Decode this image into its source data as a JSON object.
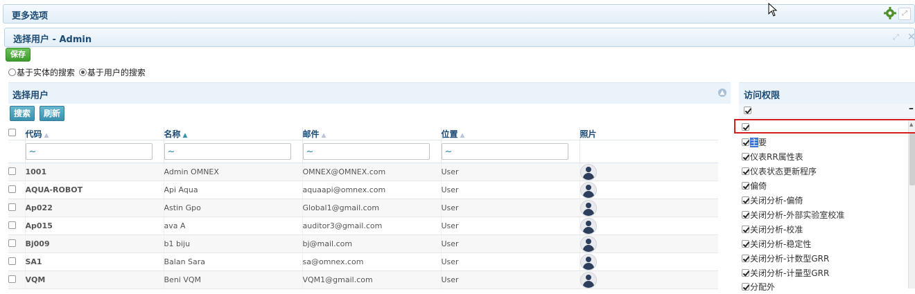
{
  "more_options": {
    "title": "更多选项"
  },
  "select_user_panel": {
    "title": "选择用户 - Admin"
  },
  "save_label": "保存",
  "search_mode": {
    "entity": "基于实体的搜索",
    "user": "基于用户的搜索",
    "selected": "user"
  },
  "user_grid": {
    "title": "选择用户",
    "search_label": "搜索",
    "refresh_label": "刷新",
    "columns": [
      "代码",
      "名称",
      "邮件",
      "位置",
      "照片"
    ],
    "filter_value": "~",
    "rows": [
      {
        "code": "1001",
        "name": "Admin OMNEX",
        "email": "OMNEX@OMNEX.com",
        "location": "User"
      },
      {
        "code": "AQUA-ROBOT",
        "name": "Api Aqua",
        "email": "aquaapi@omnex.com",
        "location": "User"
      },
      {
        "code": "Ap022",
        "name": "Astin Gpo",
        "email": "Global1@gmail.com",
        "location": "User"
      },
      {
        "code": "Ap015",
        "name": "ava A",
        "email": "auditor3@gmail.com",
        "location": "User"
      },
      {
        "code": "Bj009",
        "name": "b1 biju",
        "email": "bj@mail.com",
        "location": "User"
      },
      {
        "code": "SA1",
        "name": "Balan Sara",
        "email": "sa@omnex.com",
        "location": "User"
      },
      {
        "code": "VQM",
        "name": "Beni VQM",
        "email": "VQM1@gmail.com",
        "location": "User"
      }
    ]
  },
  "access_panel": {
    "title": "访问权限",
    "items": [
      {
        "label": "",
        "checked": true
      },
      {
        "label": "主要",
        "checked": true,
        "highlight": "主"
      },
      {
        "label": "仪表RR属性表",
        "checked": true
      },
      {
        "label": "仪表状态更新程序",
        "checked": true
      },
      {
        "label": "偏倚",
        "checked": true
      },
      {
        "label": "关闭分析-偏倚",
        "checked": true
      },
      {
        "label": "关闭分析-外部实验室校准",
        "checked": true
      },
      {
        "label": "关闭分析-校准",
        "checked": true
      },
      {
        "label": "关闭分析-稳定性",
        "checked": true
      },
      {
        "label": "关闭分析-计数型GRR",
        "checked": true
      },
      {
        "label": "关闭分析-计量型GRR",
        "checked": true
      },
      {
        "label": "分配外",
        "checked": true
      }
    ]
  },
  "colors": {
    "accent": "#1b4a73",
    "save_green": "#4caf3a",
    "button_teal": "#3a90ad",
    "focus_outline": "#d11f1f"
  }
}
